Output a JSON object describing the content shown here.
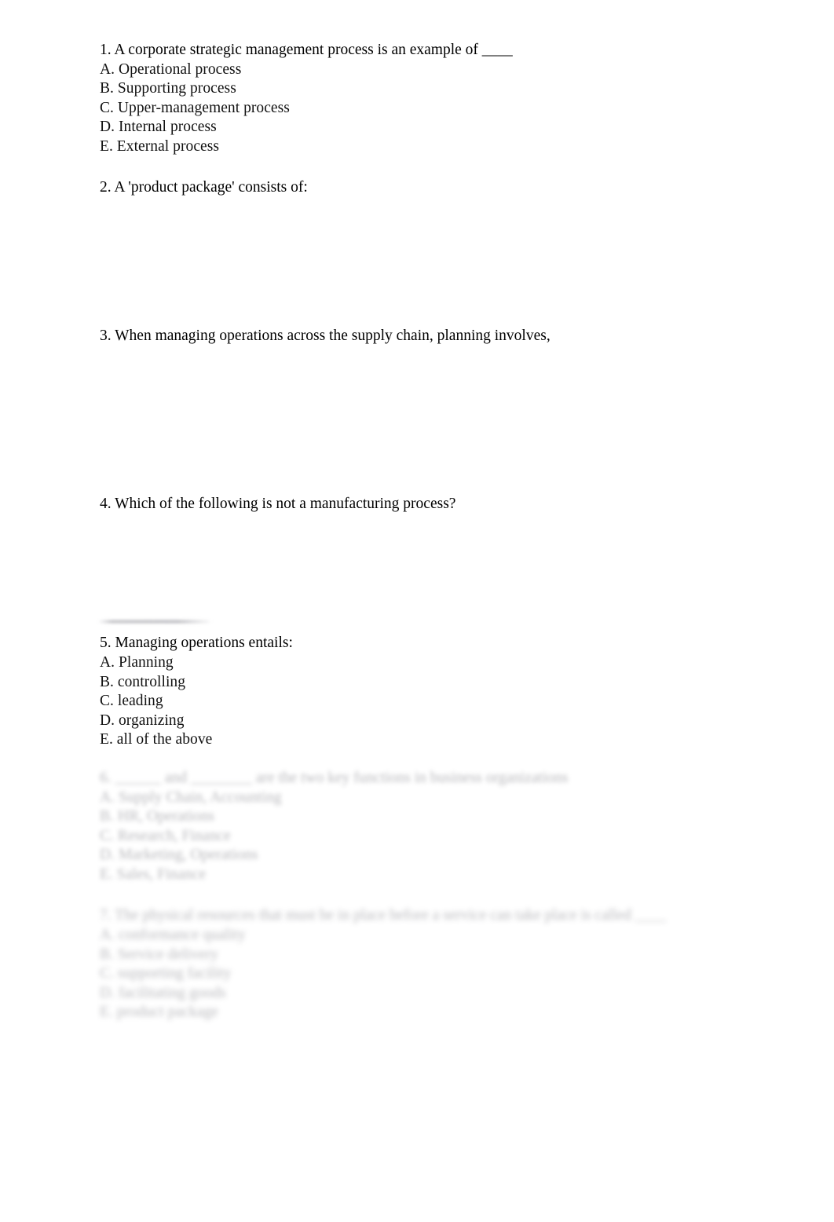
{
  "document": {
    "type": "multiple-choice-quiz",
    "page_background": "#ffffff",
    "text_color": "#111111",
    "blurred_text_color": "#b4b4b8"
  },
  "questions": [
    {
      "number": "1.",
      "stem": "1. A corporate strategic management process is an example of ____",
      "options": [
        "A. Operational process",
        "B. Supporting process",
        "C. Upper-management process",
        "D. Internal process",
        "E. External process"
      ],
      "blurred": false
    },
    {
      "number": "2.",
      "stem": "2. A 'product package' consists of:",
      "options": [],
      "blurred": false
    },
    {
      "number": "3.",
      "stem": "3. When managing operations across the supply chain, planning involves,",
      "options": [],
      "blurred": false
    },
    {
      "number": "4.",
      "stem": "4. Which of the following is not a manufacturing process?",
      "options": [],
      "blurred": false
    },
    {
      "number": "5.",
      "stem": "5. Managing operations entails:",
      "options": [
        "A. Planning",
        "B. controlling",
        "C. leading",
        "D. organizing",
        "E. all of the above"
      ],
      "blurred": false
    },
    {
      "number": "6.",
      "stem": "6. ______ and ________ are the two key functions in business organizations",
      "options": [
        "A. Supply Chain, Accounting",
        "B. HR, Operations",
        "C. Research, Finance",
        "D. Marketing, Operations",
        "E. Sales, Finance"
      ],
      "blurred": true
    },
    {
      "number": "7.",
      "stem": "7. The physical resources that must be in place before a service can take place is called ____",
      "options": [
        "A. conformance quality",
        "B. Service delivery",
        "C. supporting facility",
        "D. facilitating goods",
        "E. product package"
      ],
      "blurred": true
    }
  ]
}
